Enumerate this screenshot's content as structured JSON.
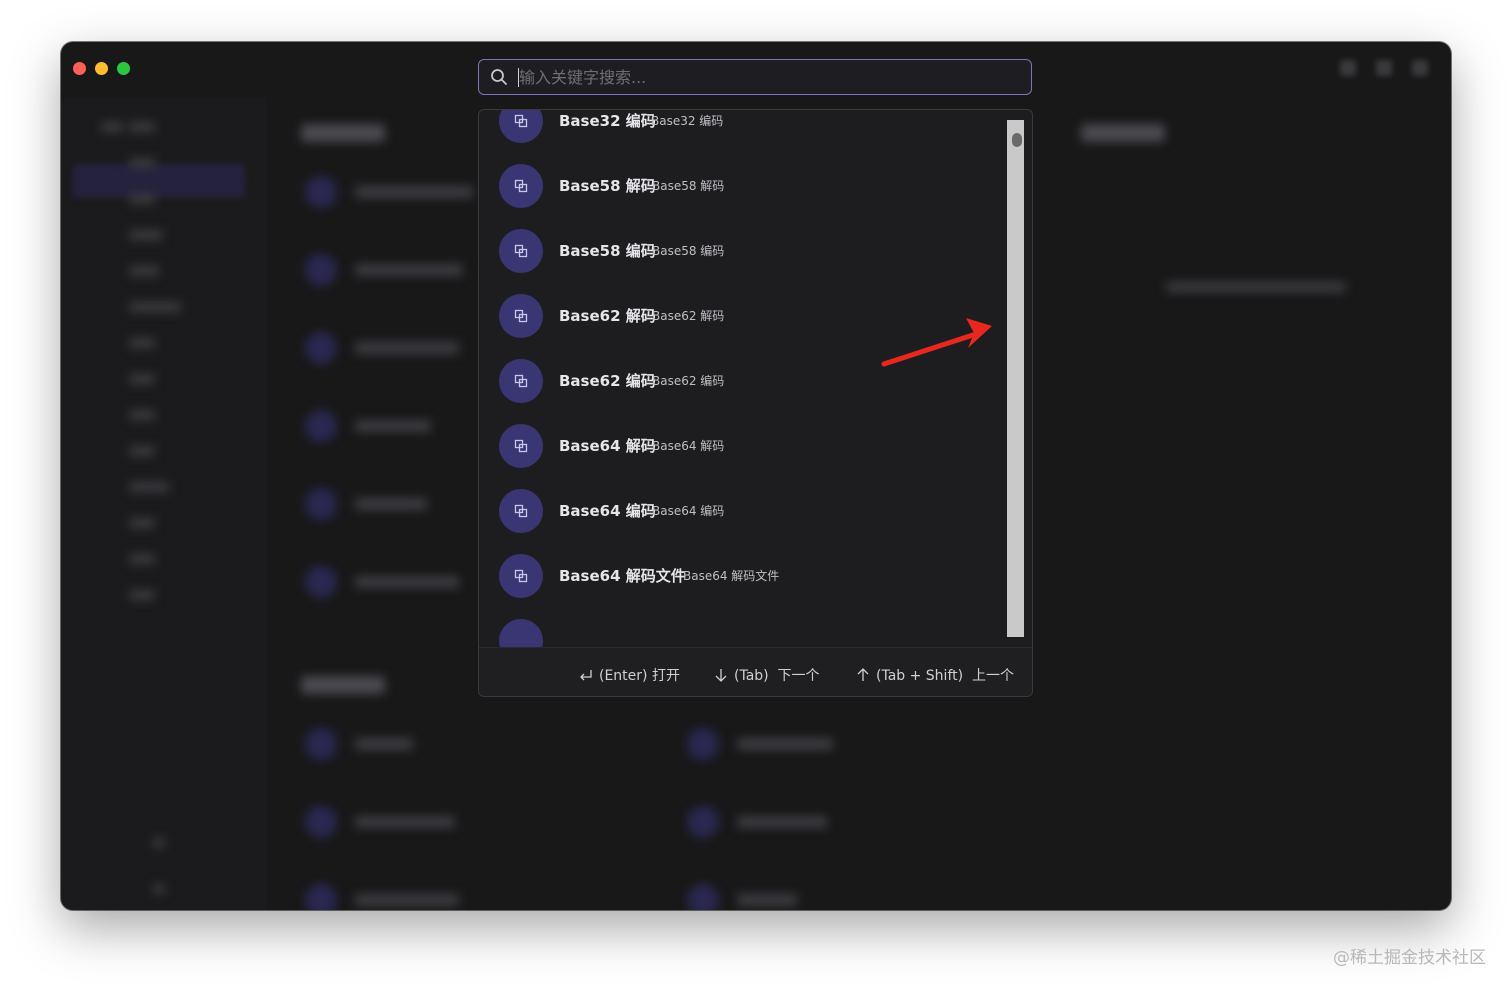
{
  "search": {
    "placeholder": "输入关键字搜索..."
  },
  "results": [
    {
      "title": "Base32 编码",
      "subtitle": "Base32 编码"
    },
    {
      "title": "Base58 解码",
      "subtitle": "Base58 解码"
    },
    {
      "title": "Base58 编码",
      "subtitle": "Base58 编码"
    },
    {
      "title": "Base62 解码",
      "subtitle": "Base62 解码"
    },
    {
      "title": "Base62 编码",
      "subtitle": "Base62 编码"
    },
    {
      "title": "Base64 解码",
      "subtitle": "Base64 解码"
    },
    {
      "title": "Base64 编码",
      "subtitle": "Base64 编码"
    },
    {
      "title": "Base64 解码文件",
      "subtitle": "Base64 解码文件"
    }
  ],
  "footer": {
    "enter_hint": "(Enter) 打开",
    "tab_hint": "(Tab)  下一个",
    "shift_tab_hint": "(Tab + Shift)  上一个"
  },
  "watermark": "@稀土掘金技术社区",
  "colors": {
    "window_bg": "#181819",
    "accent": "#7c76b6",
    "avatar": "#3a3673",
    "annotation_arrow": "#e8281e"
  },
  "icons": [
    "search-icon",
    "copy-icon",
    "enter-icon",
    "arrow-down-icon",
    "arrow-up-icon"
  ]
}
